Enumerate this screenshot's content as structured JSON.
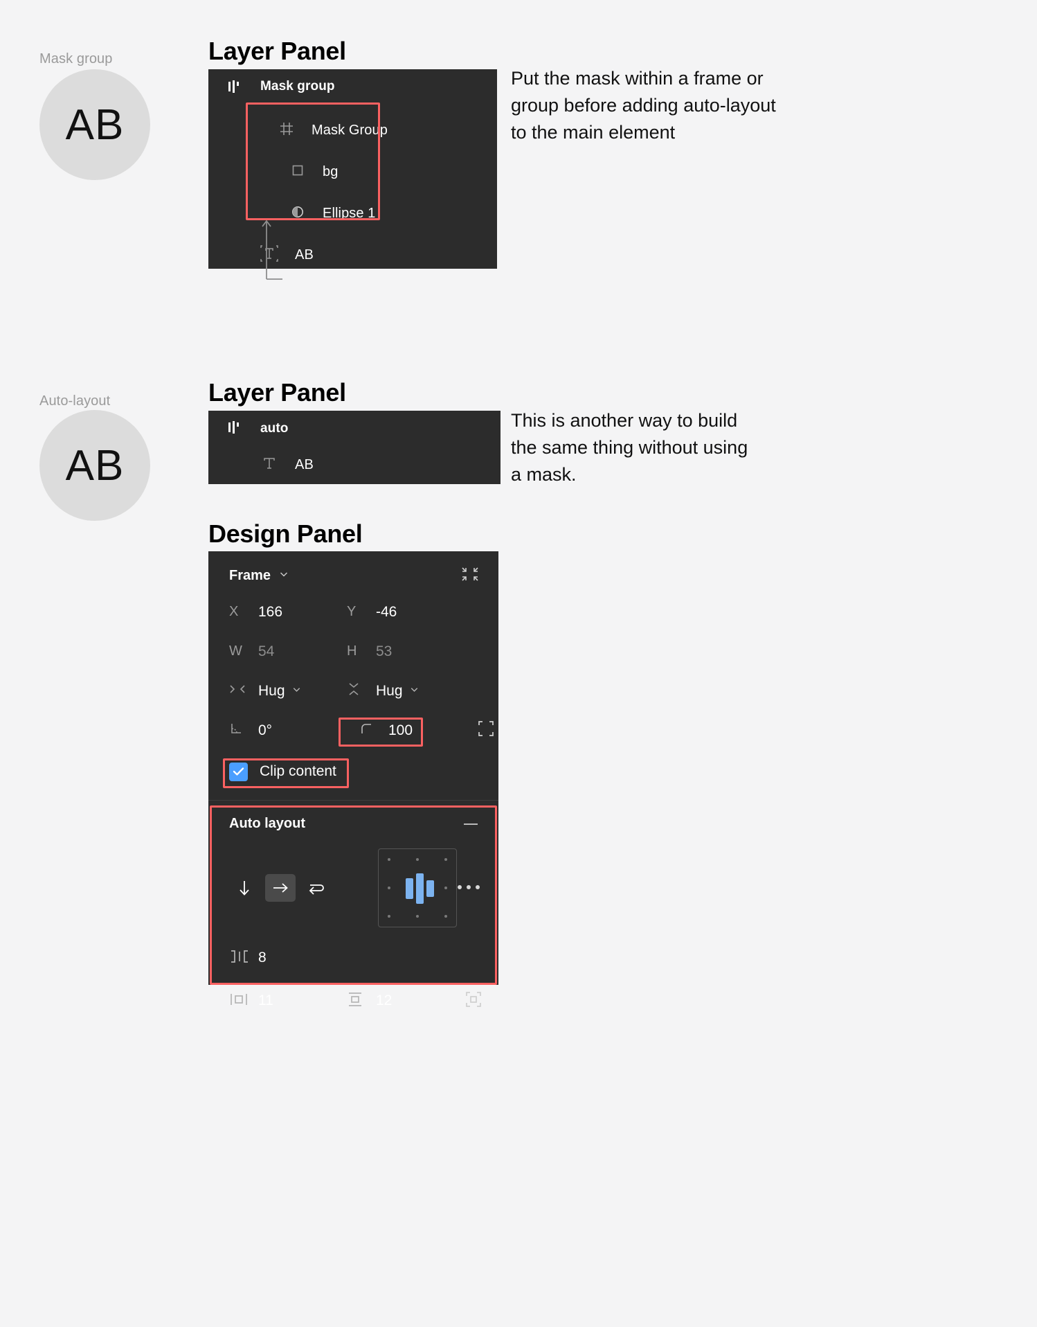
{
  "section1": {
    "caption": "Mask group",
    "avatar_text": "AB",
    "heading": "Layer Panel",
    "layers": {
      "root_label": "Mask group",
      "root_icon": "auto-layout-horizontal-icon",
      "items": [
        {
          "label": "Mask Group",
          "icon": "mask-group-icon"
        },
        {
          "label": "bg",
          "icon": "rectangle-icon"
        },
        {
          "label": "Ellipse 1",
          "icon": "mask-ellipse-icon"
        },
        {
          "label": "AB",
          "icon": "text-icon"
        }
      ]
    },
    "annotation": "Put the mask within a frame or group before adding auto-layout to the main element"
  },
  "section2": {
    "caption": "Auto-layout",
    "avatar_text": "AB",
    "heading": "Layer Panel",
    "layers": {
      "root_label": "auto",
      "root_icon": "auto-layout-horizontal-icon",
      "items": [
        {
          "label": "AB",
          "icon": "text-icon"
        }
      ]
    },
    "annotation": "This is another way to build the same thing without using a mask."
  },
  "design_panel": {
    "heading": "Design Panel",
    "type_label": "Frame",
    "type_caret": "chevron-down-icon",
    "collapse_icon": "collapse-icon",
    "properties": [
      {
        "key": "X",
        "value": "166",
        "muted": false
      },
      {
        "key": "Y",
        "value": "-46",
        "muted": false
      },
      {
        "key": "W",
        "value": "54",
        "muted": true
      },
      {
        "key": "H",
        "value": "53",
        "muted": true
      }
    ],
    "resizing": {
      "horizontal_icon": "horizontal-resize-icon",
      "horizontal_value": "Hug",
      "vertical_icon": "vertical-resize-icon",
      "vertical_value": "Hug"
    },
    "rotation": {
      "icon": "angle-icon",
      "value": "0°"
    },
    "corner_radius": {
      "icon": "corner-radius-icon",
      "value": "100"
    },
    "independent_corners_icon": "independent-corners-icon",
    "clip_content": {
      "label": "Clip content",
      "checked": true
    },
    "auto_layout": {
      "title": "Auto layout",
      "remove_icon": "minus-icon",
      "direction_vertical_icon": "arrow-down-icon",
      "direction_horizontal_icon": "arrow-right-icon",
      "direction_wrap_icon": "wrap-icon",
      "selected_direction": "horizontal",
      "more_icon": "more-options-icon",
      "gap": {
        "icon": "gap-icon",
        "value": "8"
      },
      "padding_horizontal": {
        "icon": "horizontal-padding-icon",
        "value": "11"
      },
      "padding_vertical": {
        "icon": "vertical-padding-icon",
        "value": "12"
      },
      "individual_padding_icon": "individual-padding-icon",
      "alignment": "center"
    }
  },
  "colors": {
    "panel_bg": "#2c2c2c",
    "highlight": "#fa6161",
    "accent_blue": "#4a9eff",
    "page_bg": "#f4f4f5"
  }
}
